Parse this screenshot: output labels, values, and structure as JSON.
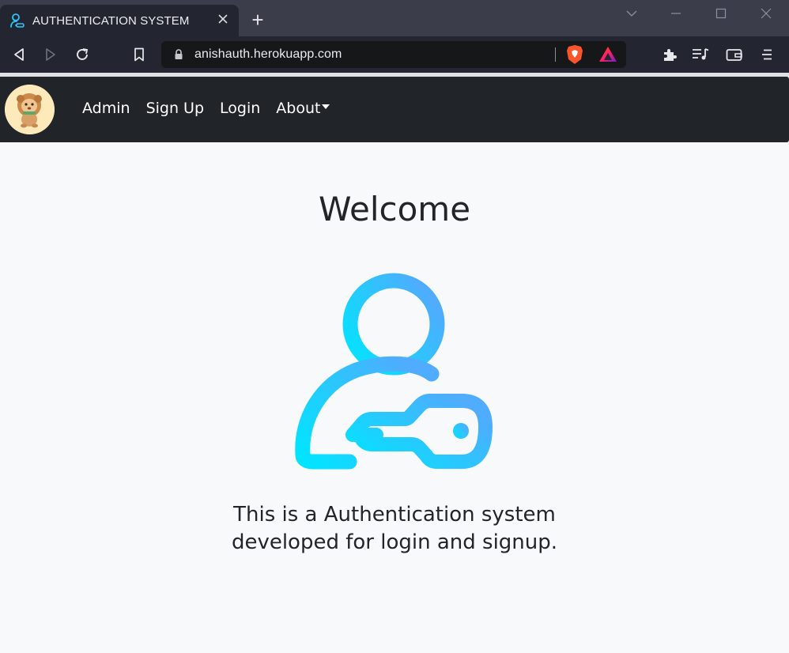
{
  "browser": {
    "tab_title": "AUTHENTICATION SYSTEM",
    "tab_icon": "user-key-icon",
    "new_tab_label": "+",
    "url": "anishauth.herokuapp.com",
    "icons": [
      "back-icon",
      "forward-icon",
      "reload-icon",
      "bookmark-icon",
      "lock-icon",
      "brave-shields-icon",
      "brave-rewards-icon",
      "extensions-icon",
      "playlist-icon",
      "wallet-icon",
      "menu-icon"
    ]
  },
  "navbar": {
    "logo": "lion-avatar-logo",
    "links": [
      {
        "label": "Admin"
      },
      {
        "label": "Sign Up"
      },
      {
        "label": "Login"
      },
      {
        "label": "About"
      }
    ]
  },
  "main": {
    "title": "Welcome",
    "hero_icon": "user-key-icon",
    "description_line1": "This is a Authentication system",
    "description_line2": "developed for login and signup."
  },
  "colors": {
    "navbar_bg": "#212529",
    "page_bg": "#f8f9fa",
    "icon_gradient_start": "#00e5ff",
    "icon_gradient_end": "#4facfe",
    "brave_orange": "#fb542b"
  }
}
